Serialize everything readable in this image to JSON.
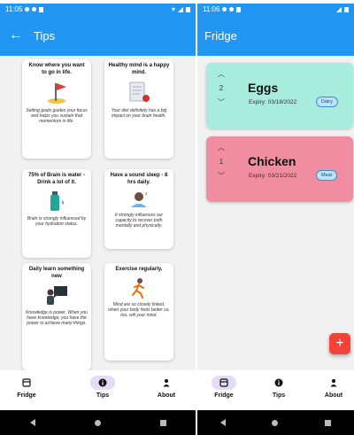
{
  "left_screen": {
    "status_time": "11:05",
    "app_bar_title": "Tips",
    "tips": [
      {
        "title": "Know where you want to go in life.",
        "body": "Setting goals guides your focus and helps you sustain that momentum in life.",
        "icon": "flag-goal-icon"
      },
      {
        "title": "Healthy mind is a happy mind.",
        "body": "Your diet definitely has a big impact on your brain health.",
        "icon": "notebook-apple-icon"
      },
      {
        "title": "75% of Brain is water - Drink a lot of it.",
        "body": "Brain is strongly influenced by your hydration status.",
        "icon": "water-bottle-icon"
      },
      {
        "title": "Have a sound sleep - 8 hrs daily.",
        "body": "It strongly influences our capacity to recover both mentally and physically.",
        "icon": "sleeping-person-icon"
      },
      {
        "title": "Daily learn something new",
        "body": "Knowledge is power. When you have knowledge, you have the power to achieve many things.",
        "icon": "teacher-board-icon"
      },
      {
        "title": "Exercise regularly.",
        "body": "Mind are so closely linked, when your body feels better so, too, will your mind.",
        "icon": "running-person-icon"
      }
    ]
  },
  "right_screen": {
    "status_time": "11:06",
    "app_bar_title": "Fridge",
    "foods": [
      {
        "name": "Eggs",
        "quantity": "2",
        "expiry": "Expiry: 03/18/2022",
        "tag": "Dairy",
        "color": "#a7ecdd"
      },
      {
        "name": "Chicken",
        "quantity": "1",
        "expiry": "Expiry: 03/21/2022",
        "tag": "Meat",
        "color": "#f18da1"
      }
    ],
    "fab_label": "+"
  },
  "bottom_nav": {
    "items": [
      {
        "label": "Fridge",
        "icon": "fridge-icon"
      },
      {
        "label": "Tips",
        "icon": "info-icon"
      },
      {
        "label": "About",
        "icon": "person-icon"
      }
    ]
  },
  "colors": {
    "primary": "#2196f3",
    "nav_active": "#e3dcf7",
    "fab": "#f44336"
  }
}
